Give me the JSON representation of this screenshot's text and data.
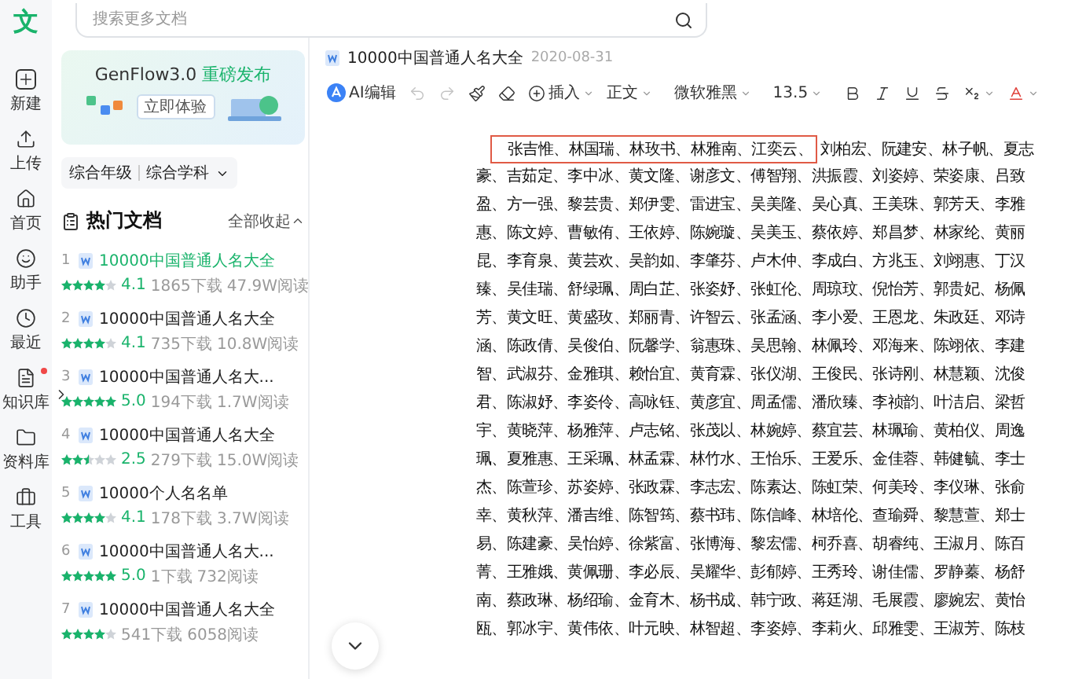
{
  "nav": {
    "logo": "文",
    "items": [
      {
        "kind": "new",
        "label": "新建",
        "notification": false
      },
      {
        "kind": "upload",
        "label": "上传",
        "notification": false
      },
      {
        "kind": "home",
        "label": "首页",
        "notification": false
      },
      {
        "kind": "assistant",
        "label": "助手",
        "notification": false
      },
      {
        "kind": "recent",
        "label": "最近",
        "notification": false
      },
      {
        "kind": "knowledge",
        "label": "知识库",
        "notification": true
      },
      {
        "kind": "library",
        "label": "资料库",
        "notification": false
      },
      {
        "kind": "tools",
        "label": "工具",
        "notification": false
      }
    ]
  },
  "search": {
    "placeholder": "搜索更多文档"
  },
  "banner": {
    "title": "GenFlow3.0",
    "highlight": "重磅发布",
    "button": "立即体验"
  },
  "filters": [
    "综合年级",
    "综合学科"
  ],
  "hot_docs": {
    "title": "热门文档",
    "toggle": "全部收起",
    "items": [
      {
        "rank": "1",
        "title": "10000中国普通人名大全",
        "selected": true,
        "stars": 4,
        "rating": "4.1",
        "downloads": "1865下载",
        "reads": "47.9W阅读"
      },
      {
        "rank": "2",
        "title": "10000中国普通人名大全",
        "selected": false,
        "stars": 4,
        "rating": "4.1",
        "downloads": "735下载",
        "reads": "10.8W阅读"
      },
      {
        "rank": "3",
        "title": "10000中国普通人名大...",
        "selected": false,
        "stars": 5,
        "rating": "5.0",
        "downloads": "194下载",
        "reads": "1.7W阅读"
      },
      {
        "rank": "4",
        "title": "10000中国普通人名大全",
        "selected": false,
        "stars": 2.5,
        "rating": "2.5",
        "downloads": "279下载",
        "reads": "15.0W阅读"
      },
      {
        "rank": "5",
        "title": "10000个人名名单",
        "selected": false,
        "stars": 4,
        "rating": "4.1",
        "downloads": "178下载",
        "reads": "3.7W阅读"
      },
      {
        "rank": "6",
        "title": "10000中国普通人名大...",
        "selected": false,
        "stars": 5,
        "rating": "5.0",
        "downloads": "1下载",
        "reads": "732阅读"
      },
      {
        "rank": "7",
        "title": "10000中国普通人名大全",
        "selected": false,
        "stars": 4,
        "downloads": "541下载",
        "reads": "6058阅读"
      }
    ]
  },
  "document": {
    "title": "10000中国普通人名大全",
    "date": "2020-08-31",
    "toolbar": [
      {
        "kind": "ai",
        "label": "AI编辑",
        "dropdown": false,
        "disabled": false
      },
      {
        "kind": "undo",
        "dropdown": false,
        "disabled": true
      },
      {
        "kind": "redo",
        "dropdown": false,
        "disabled": true
      },
      {
        "kind": "painter",
        "dropdown": false,
        "disabled": false
      },
      {
        "kind": "eraser",
        "dropdown": false,
        "disabled": false
      },
      {
        "kind": "insert",
        "label": "插入",
        "dropdown": true,
        "disabled": false
      },
      {
        "kind": "text",
        "label": "正文",
        "dropdown": true,
        "disabled": false
      },
      {
        "kind": "text",
        "label": "微软雅黑",
        "dropdown": true,
        "disabled": false
      },
      {
        "kind": "text",
        "label": "13.5",
        "dropdown": true,
        "disabled": false
      },
      {
        "kind": "bold",
        "dropdown": false,
        "disabled": false
      },
      {
        "kind": "italic",
        "dropdown": false,
        "disabled": false
      },
      {
        "kind": "underline",
        "dropdown": false,
        "disabled": false
      },
      {
        "kind": "strike",
        "dropdown": false,
        "disabled": false
      },
      {
        "kind": "subscript",
        "dropdown": true,
        "disabled": false
      },
      {
        "kind": "color",
        "dropdown": true,
        "disabled": false
      }
    ],
    "highlighted": "张吉惟、林国瑞、林玫书、林雅南、江奕云、",
    "lines": [
      "刘柏宏、阮建安、林子帆、夏志",
      "豪、吉茹定、李中冰、黄文隆、谢彦文、傅智翔、洪振霞、刘姿婷、荣姿康、吕致",
      "盈、方一强、黎芸贵、郑伊雯、雷进宝、吴美隆、吴心真、王美珠、郭芳天、李雅",
      "惠、陈文婷、曹敏侑、王依婷、陈婉璇、吴美玉、蔡依婷、郑昌梦、林家纶、黄丽",
      "昆、李育泉、黄芸欢、吴韵如、李肇芬、卢木仲、李成白、方兆玉、刘翊惠、丁汉",
      "臻、吴佳瑞、舒绿珮、周白芷、张姿妤、张虹伦、周琼玟、倪怡芳、郭贵妃、杨佩",
      "芳、黄文旺、黄盛玫、郑丽青、许智云、张孟涵、李小爱、王恩龙、朱政廷、邓诗",
      "涵、陈政倩、吴俊伯、阮馨学、翁惠珠、吴思翰、林佩玲、邓海来、陈翊依、李建",
      "智、武淑芬、金雅琪、赖怡宜、黄育霖、张仪湖、王俊民、张诗刚、林慧颖、沈俊",
      "君、陈淑妤、李姿伶、高咏钰、黄彦宜、周孟儒、潘欣臻、李祯韵、叶洁启、梁哲",
      "宇、黄晓萍、杨雅萍、卢志铭、张茂以、林婉婷、蔡宜芸、林珮瑜、黄柏仪、周逸",
      "珮、夏雅惠、王采珮、林孟霖、林竹水、王怡乐、王爱乐、金佳蓉、韩健毓、李士",
      "杰、陈萱珍、苏姿婷、张政霖、李志宏、陈素达、陈虹荣、何美玲、李仪琳、张俞",
      "幸、黄秋萍、潘吉维、陈智筠、蔡书玮、陈信峰、林培伦、查瑜舜、黎慧萱、郑士",
      "易、陈建豪、吴怡婷、徐紫富、张博海、黎宏儒、柯乔喜、胡睿纯、王淑月、陈百",
      "菁、王雅娥、黄佩珊、李必辰、吴耀华、彭郁婷、王秀玲、谢佳儒、罗静蓁、杨舒",
      "南、蔡政琳、杨绍瑜、金育木、杨书成、韩宁政、蒋廷湖、毛展霞、廖婉宏、黄怡",
      "瓯、郭冰宇、黄伟依、叶元映、林智超、李姿婷、李莉火、邱雅雯、王淑芳、陈枝"
    ]
  }
}
